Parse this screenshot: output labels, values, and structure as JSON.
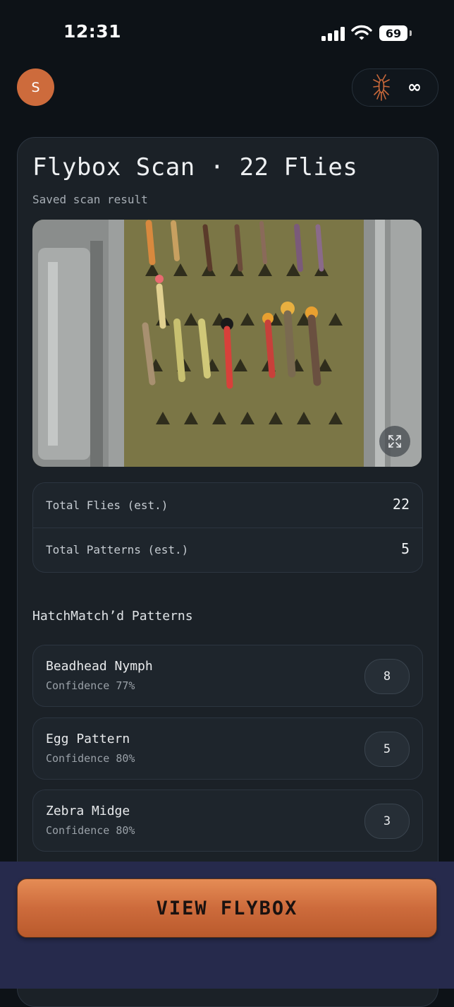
{
  "status_bar": {
    "time": "12:31",
    "battery": "69",
    "signal_icon": "cellular-signal-icon",
    "wifi_icon": "wifi-icon",
    "battery_icon": "battery-icon"
  },
  "header": {
    "avatar_initial": "S",
    "credits_icon": "mayfly-bug-icon",
    "credits_value": "∞"
  },
  "scan": {
    "title": "Flybox Scan · 22 Flies",
    "subtitle": "Saved scan result",
    "photo_icon": "expand-icon",
    "stats": [
      {
        "label": "Total Flies (est.)",
        "value": "22"
      },
      {
        "label": "Total Patterns (est.)",
        "value": "5"
      }
    ],
    "section_title": "HatchMatch’d Patterns",
    "patterns": [
      {
        "name": "Beadhead Nymph",
        "confidence": "Confidence 77%",
        "count": "8"
      },
      {
        "name": "Egg Pattern",
        "confidence": "Confidence 80%",
        "count": "5"
      },
      {
        "name": "Zebra Midge",
        "confidence": "Confidence 80%",
        "count": "3"
      }
    ]
  },
  "footer": {
    "button_label": "VIEW FLYBOX"
  },
  "colors": {
    "background": "#0d1217",
    "card": "#1b2127",
    "accent": "#cd6b3c",
    "bottom_bar": "#262a4c"
  }
}
